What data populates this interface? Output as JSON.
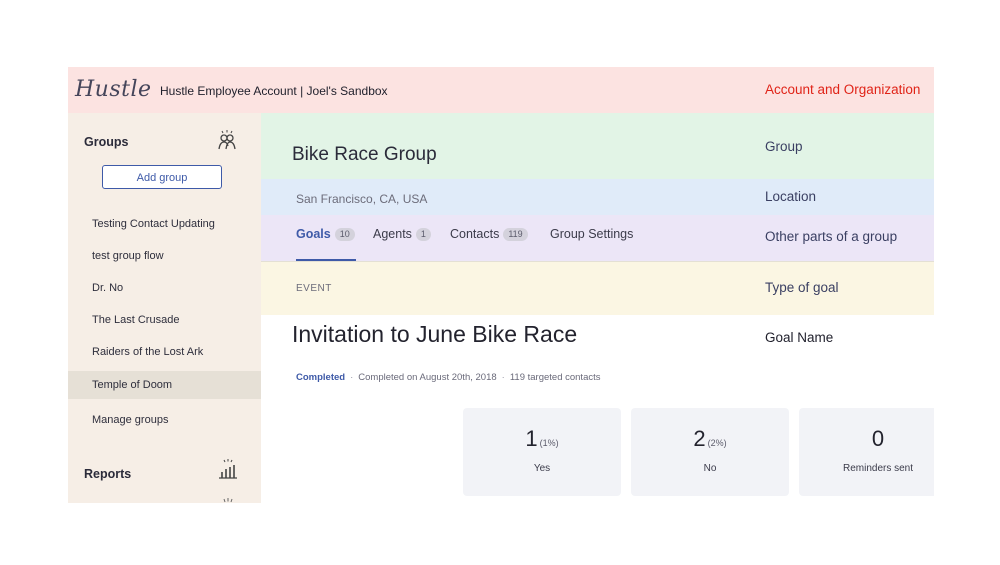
{
  "header": {
    "logo": "Hustle",
    "account": "Hustle Employee Account | Joel's Sandbox"
  },
  "annotations": {
    "account_org": "Account and Organization",
    "group": "Group",
    "location": "Location",
    "other_parts": "Other parts of a group",
    "type_of_goal": "Type of goal",
    "goal_name": "Goal Name"
  },
  "sidebar": {
    "groups_heading": "Groups",
    "add_group": "Add group",
    "items": [
      {
        "label": "Testing Contact Updating"
      },
      {
        "label": "test group flow"
      },
      {
        "label": "Dr. No"
      },
      {
        "label": "The Last Crusade"
      },
      {
        "label": "Raiders of the Lost Ark"
      },
      {
        "label": "Temple of Doom",
        "active": true
      }
    ],
    "manage_groups": "Manage groups",
    "reports_heading": "Reports"
  },
  "group": {
    "name": "Bike Race Group",
    "location": "San Francisco, CA, USA"
  },
  "tabs": [
    {
      "label": "Goals",
      "count": "10",
      "active": true
    },
    {
      "label": "Agents",
      "count": "1"
    },
    {
      "label": "Contacts",
      "count": "119"
    },
    {
      "label": "Group Settings"
    }
  ],
  "goal": {
    "type": "EVENT",
    "name": "Invitation to June Bike Race",
    "status": "Completed",
    "completed_on": "Completed on August 20th, 2018",
    "targeted": "119 targeted contacts"
  },
  "stats": [
    {
      "value": "1",
      "pct": "(1%)",
      "label": "Yes"
    },
    {
      "value": "2",
      "pct": "(2%)",
      "label": "No"
    },
    {
      "value": "0",
      "pct": "",
      "label": "Reminders sent"
    }
  ],
  "icons": {
    "groups": "people-icon",
    "reports": "bar-chart-icon"
  },
  "colors": {
    "accent": "#3e5aa8",
    "annotation_red": "#e02418",
    "topbar": "#fce3e1",
    "group_band": "#e2f4e6",
    "location_band": "#e0ebf9",
    "tabs_band": "#ece6f7",
    "event_band": "#fbf6e3",
    "sidebar": "#f6eee6"
  }
}
